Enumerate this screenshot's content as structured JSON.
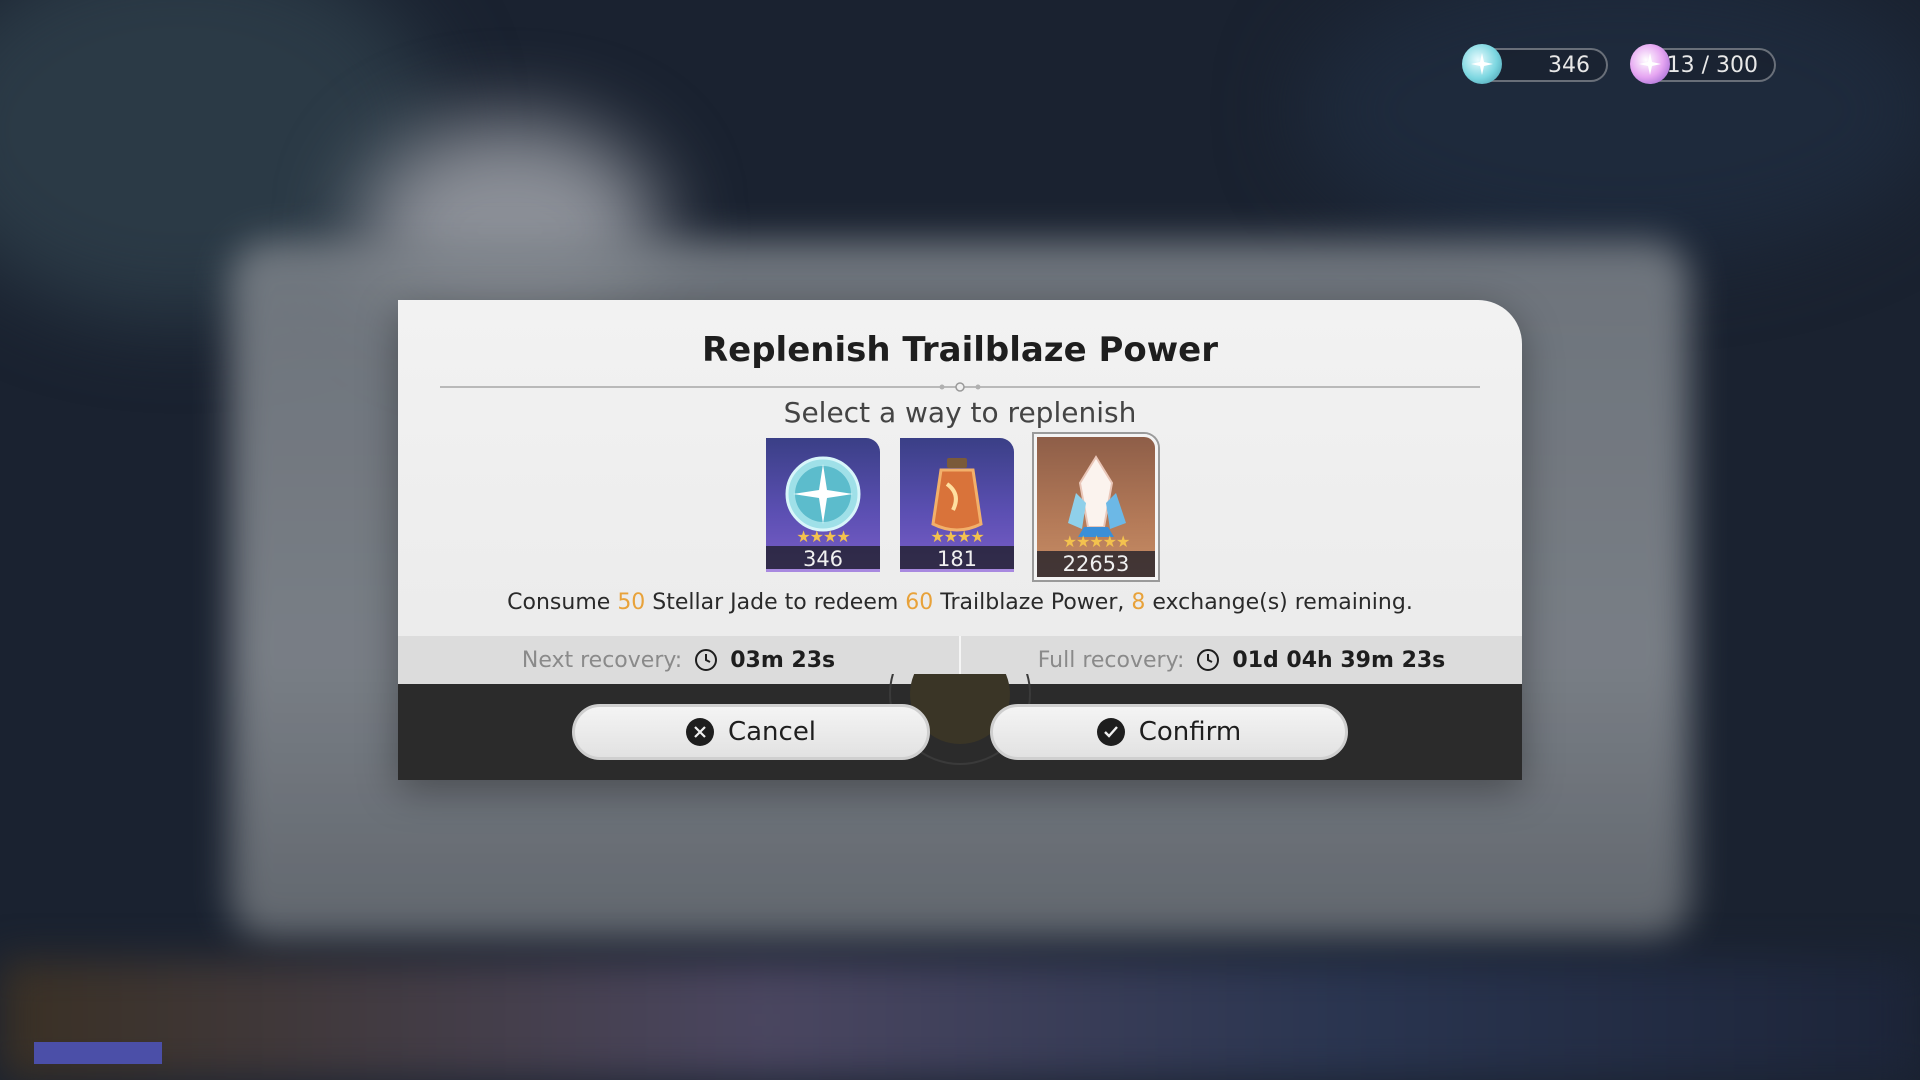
{
  "currency": {
    "stellar_jade": "346",
    "trailblaze_power": "13 / 300"
  },
  "dialog": {
    "title": "Replenish Trailblaze Power",
    "subtitle": "Select a way to replenish",
    "items": [
      {
        "name": "Stellar Jade",
        "count": "346",
        "stars": "★★★★",
        "selected": false
      },
      {
        "name": "Fuel",
        "count": "181",
        "stars": "★★★★",
        "selected": false
      },
      {
        "name": "Oneiric Shard",
        "count": "22653",
        "stars": "★★★★★",
        "selected": true
      }
    ],
    "description": {
      "p1": "Consume ",
      "jade_amount": "50",
      "p2": " Stellar Jade to redeem ",
      "power_amount": "60",
      "p3": " Trailblaze Power, ",
      "exchanges": "8",
      "p4": " exchange(s) remaining."
    },
    "recovery": {
      "next_label": "Next recovery:",
      "next_value": "03m 23s",
      "full_label": "Full recovery:",
      "full_value": "01d 04h 39m 23s"
    },
    "buttons": {
      "cancel": "Cancel",
      "confirm": "Confirm"
    }
  },
  "colors": {
    "highlight": "#e8a23a",
    "footer": "#2b2b2b",
    "stray_bar": "#4b4fa8"
  }
}
